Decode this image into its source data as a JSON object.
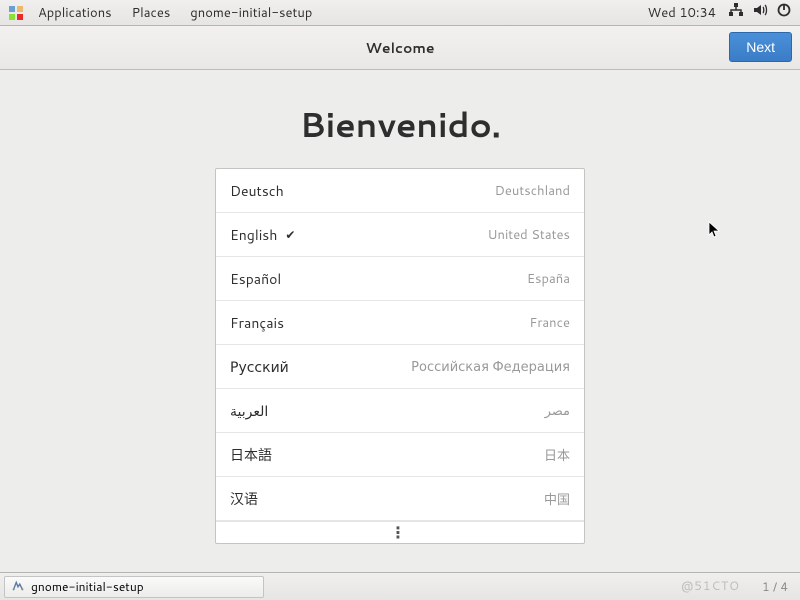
{
  "topbar": {
    "applications": "Applications",
    "places": "Places",
    "app": "gnome-initial-setup",
    "clock": "Wed 10:34"
  },
  "header": {
    "title": "Welcome",
    "next": "Next"
  },
  "heading": "Bienvenido.",
  "languages": [
    {
      "name": "Deutsch",
      "country": "Deutschland",
      "selected": false
    },
    {
      "name": "English",
      "country": "United States",
      "selected": true
    },
    {
      "name": "Español",
      "country": "España",
      "selected": false
    },
    {
      "name": "Français",
      "country": "France",
      "selected": false
    },
    {
      "name": "Русский",
      "country": "Российская Федерация",
      "selected": false
    },
    {
      "name": "العربية",
      "country": "مصر",
      "selected": false
    },
    {
      "name": "日本語",
      "country": "日本",
      "selected": false
    },
    {
      "name": "汉语",
      "country": "中国",
      "selected": false
    }
  ],
  "more_indicator": "⋮",
  "taskbar": {
    "app": "gnome-initial-setup",
    "pager": "1 / 4"
  },
  "watermark": "@51CTO"
}
